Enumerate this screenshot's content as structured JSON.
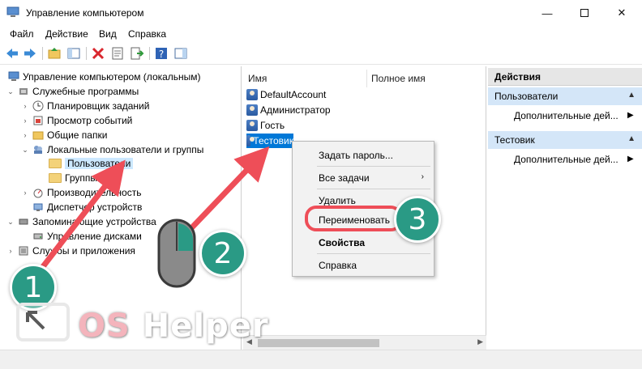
{
  "window": {
    "title": "Управление компьютером",
    "minimize": "—",
    "close": "✕"
  },
  "menu": [
    "Файл",
    "Действие",
    "Вид",
    "Справка"
  ],
  "tree": {
    "root": "Управление компьютером (локальным)",
    "system_tools": "Служебные программы",
    "task_scheduler": "Планировщик заданий",
    "event_viewer": "Просмотр событий",
    "shared_folders": "Общие папки",
    "local_users_groups": "Локальные пользователи и группы",
    "users": "Пользователи",
    "groups": "Группы",
    "performance": "Производительность",
    "device_manager": "Диспетчер устройств",
    "storage": "Запоминающие устройства",
    "disk_management": "Управление дисками",
    "services_apps": "Службы и приложения"
  },
  "list": {
    "col_name": "Имя",
    "col_fullname": "Полное имя",
    "users": [
      "DefaultAccount",
      "Администратор",
      "Гость",
      "Тестовик"
    ]
  },
  "context_menu": {
    "set_password": "Задать пароль...",
    "all_tasks": "Все задачи",
    "delete": "Удалить",
    "rename": "Переименовать",
    "properties": "Свойства",
    "help": "Справка"
  },
  "actions": {
    "header": "Действия",
    "section1": "Пользователи",
    "more1": "Дополнительные дей...",
    "section2": "Тестовик",
    "more2": "Дополнительные дей..."
  },
  "annotations": {
    "step1": "1",
    "step2": "2",
    "step3": "3",
    "accent_color": "#ee4e58",
    "badge_color": "#2a9a85"
  },
  "watermark": {
    "os": "OS",
    "helper": "Helper"
  }
}
